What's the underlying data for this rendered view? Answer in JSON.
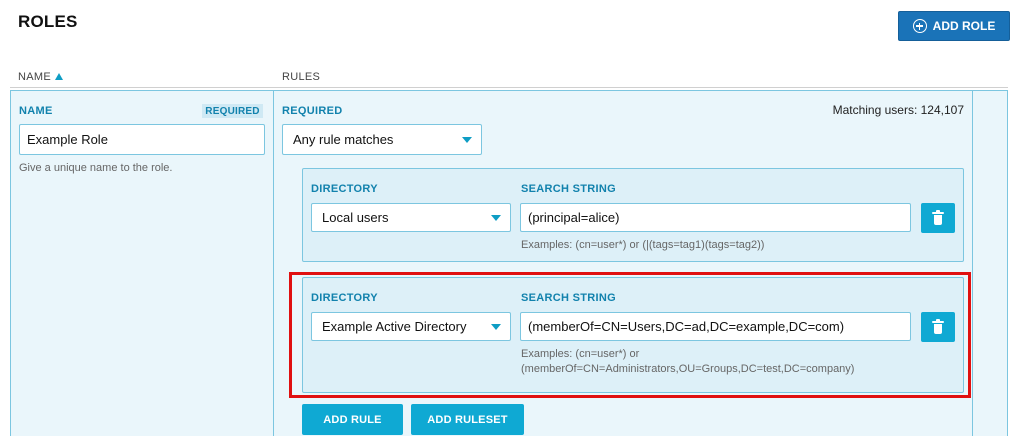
{
  "page": {
    "title": "ROLES"
  },
  "toolbar": {
    "add_role_label": "ADD ROLE",
    "add_role_icon": "plus-circle-icon"
  },
  "table": {
    "columns": [
      {
        "label": "NAME",
        "sort": "ascending"
      },
      {
        "label": "RULES"
      }
    ]
  },
  "role": {
    "name_label": "NAME",
    "required_badge": "REQUIRED",
    "name_value": "Example Role",
    "name_hint": "Give a unique name to the role."
  },
  "rules": {
    "required_label": "REQUIRED",
    "match_mode": "Any rule matches",
    "matching_users": "Matching users: 124,107",
    "items": [
      {
        "directory_label": "DIRECTORY",
        "directory_value": "Local users",
        "search_label": "SEARCH STRING",
        "search_value": "(principal=alice)",
        "examples": "Examples: (cn=user*) or (|(tags=tag1)(tags=tag2))"
      },
      {
        "directory_label": "DIRECTORY",
        "directory_value": "Example Active Directory",
        "search_label": "SEARCH STRING",
        "search_value": "(memberOf=CN=Users,DC=ad,DC=example,DC=com)",
        "examples_line1": "Examples: (cn=user*) or",
        "examples_line2": "(memberOf=CN=Administrators,OU=Groups,DC=test,DC=company)"
      }
    ],
    "add_rule_label": "ADD RULE",
    "add_ruleset_label": "ADD RULESET"
  },
  "colors": {
    "primary": "#1a73b8",
    "accent": "#0fa9d3",
    "label": "#1282ad",
    "row_bg": "#eaf6fb",
    "highlight": "#e01010"
  }
}
